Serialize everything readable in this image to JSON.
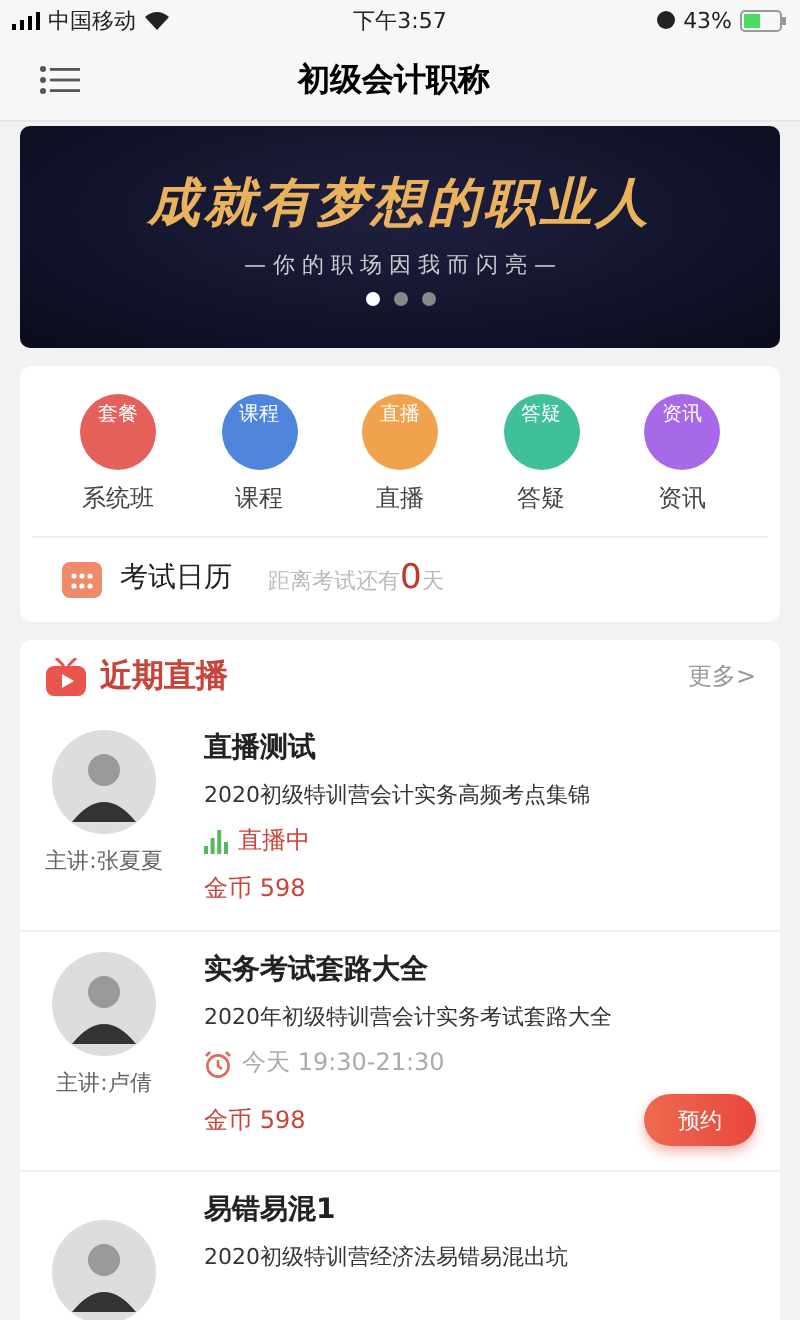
{
  "status_bar": {
    "carrier": "中国移动",
    "time": "下午3:57",
    "battery": "43%"
  },
  "nav": {
    "title": "初级会计职称"
  },
  "banner": {
    "headline": "成就有梦想的职业人",
    "tagline": "— 你 的 职 场 因 我 而 闪 亮 —",
    "dots": [
      {
        "selected": true
      },
      {
        "selected": false
      },
      {
        "selected": false
      }
    ]
  },
  "menu": [
    {
      "badge": "套餐",
      "label": "系统班",
      "color": "#e4605a"
    },
    {
      "badge": "课程",
      "label": "课程",
      "color": "#4f86dc"
    },
    {
      "badge": "直播",
      "label": "直播",
      "color": "#f0a24c"
    },
    {
      "badge": "答疑",
      "label": "答疑",
      "color": "#3fbf9a"
    },
    {
      "badge": "资讯",
      "label": "资讯",
      "color": "#a66ae8"
    }
  ],
  "calendar": {
    "title": "考试日历",
    "prefix": "距离考试还有",
    "days": "0",
    "suffix": "天"
  },
  "live_section": {
    "title": "近期直播",
    "more": "更多>",
    "items": [
      {
        "kind": "live",
        "title": "直播测试",
        "subtitle": "2020初级特训营会计实务高频考点集锦",
        "status": "直播中",
        "price": "金币 598",
        "teacher": "主讲:张夏夏"
      },
      {
        "kind": "scheduled",
        "title": "实务考试套路大全",
        "subtitle": "2020年初级特训营会计实务考试套路大全",
        "status": "今天 19:30-21:30",
        "price": "金币 598",
        "teacher": "主讲:卢倩",
        "button": "预约"
      },
      {
        "kind": "partial",
        "title": "易错易混1",
        "subtitle": "2020初级特训营经济法易错易混出坑"
      }
    ]
  }
}
